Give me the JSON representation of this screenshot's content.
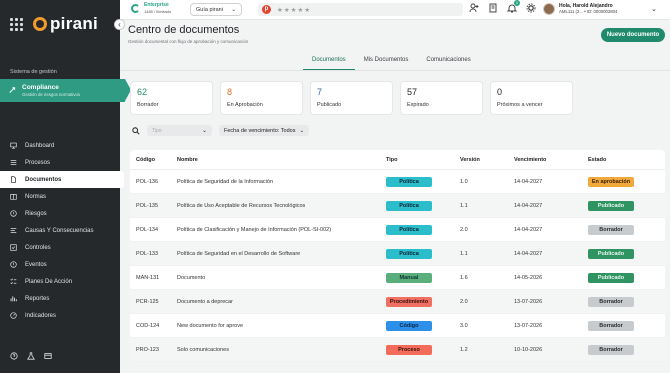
{
  "brand": {
    "name": "pirani"
  },
  "sidebar": {
    "section_label": "Sistema de gestión",
    "module": {
      "title": "Compliance",
      "subtitle": "Gestión de riesgos normativos"
    },
    "items": [
      {
        "label": "Dashboard",
        "icon": "monitor-icon"
      },
      {
        "label": "Procesos",
        "icon": "list-icon"
      },
      {
        "label": "Documentos",
        "icon": "document-icon"
      },
      {
        "label": "Normas",
        "icon": "book-icon"
      },
      {
        "label": "Riesgos",
        "icon": "warning-icon"
      },
      {
        "label": "Causas Y Consecuencias",
        "icon": "branch-icon"
      },
      {
        "label": "Controles",
        "icon": "controls-icon"
      },
      {
        "label": "Eventos",
        "icon": "alert-circle-icon"
      },
      {
        "label": "Planes De Acción",
        "icon": "checklist-icon"
      },
      {
        "label": "Reportes",
        "icon": "chart-icon"
      },
      {
        "label": "Indicadores",
        "icon": "gauge-icon"
      }
    ]
  },
  "topbar": {
    "plan_name": "Enterprise",
    "plan_users": "1485 / Ilimitado",
    "guide_label": "Guía pirani",
    "stars": "★★★★★",
    "user_name": "Hola, Harold Alejandro",
    "user_id": "AML111 (2... • ID: 0000002804",
    "notif_count": "1"
  },
  "page": {
    "title": "Centro de documentos",
    "subtitle": "Gestión documental con flujo de aprobación y comunicación",
    "new_button": "Nuevo documento",
    "tabs": [
      "Documentos",
      "Mis Documentos",
      "Comunicaciones"
    ]
  },
  "stats": [
    {
      "value": "62",
      "label": "Borrador",
      "color": "#1f8b6c"
    },
    {
      "value": "8",
      "label": "En Aprobación",
      "color": "#e0702a"
    },
    {
      "value": "7",
      "label": "Publicado",
      "color": "#3a5fb0"
    },
    {
      "value": "57",
      "label": "Expirado",
      "color": "#222222"
    },
    {
      "value": "0",
      "label": "Próximos a vencer",
      "color": "#222222"
    }
  ],
  "filters": {
    "type_placeholder": "Tipo",
    "due_label": "Fecha de vencimiento: Todos"
  },
  "table": {
    "headers": [
      "Código",
      "Nombre",
      "Tipo",
      "Versión",
      "Vencimiento",
      "Estado"
    ],
    "rows": [
      {
        "code": "POL-136",
        "name": "Política de Seguridad de la Información",
        "type": "Política",
        "version": "1.0",
        "due": "14-04-2027",
        "status": "En aprobación"
      },
      {
        "code": "POL-135",
        "name": "Política de Uso Aceptable de Recursos Tecnológicos",
        "type": "Política",
        "version": "1.1",
        "due": "14-04-2027",
        "status": "Publicado"
      },
      {
        "code": "POL-134",
        "name": "Política de Clasificación y Manejo de Información (POL-SI-002)",
        "type": "Política",
        "version": "2.0",
        "due": "14-04-2027",
        "status": "Borrador"
      },
      {
        "code": "POL-133",
        "name": "Política de Seguridad en el Desarrollo de Software",
        "type": "Política",
        "version": "1.1",
        "due": "14-04-2027",
        "status": "Publicado"
      },
      {
        "code": "MAN-131",
        "name": "Documento",
        "type": "Manual",
        "version": "1.6",
        "due": "14-05-2026",
        "status": "Publicado"
      },
      {
        "code": "PCR-125",
        "name": "Documento a deprecar",
        "type": "Procedimiento",
        "version": "2.0",
        "due": "13-07-2026",
        "status": "Borrador"
      },
      {
        "code": "COD-124",
        "name": "New documento for aprove",
        "type": "Código",
        "version": "3.0",
        "due": "13-07-2026",
        "status": "Borrador"
      },
      {
        "code": "PRO-123",
        "name": "Solo comunicaciones",
        "type": "Proceso",
        "version": "1.2",
        "due": "10-10-2026",
        "status": "Borrador"
      }
    ]
  }
}
